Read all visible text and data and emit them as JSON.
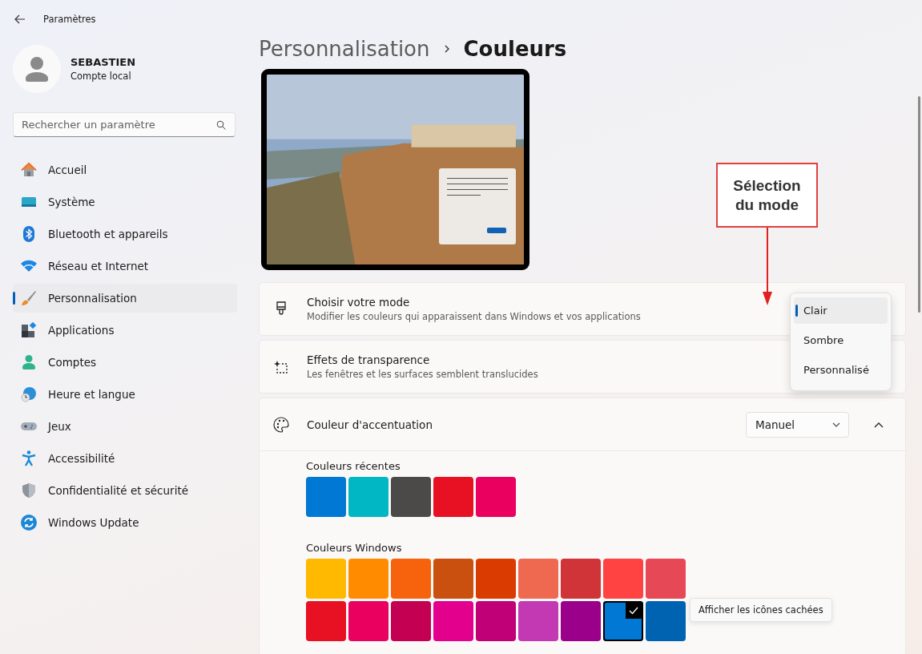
{
  "window": {
    "title": "Paramètres"
  },
  "user": {
    "name": "SEBASTIEN",
    "account": "Compte local"
  },
  "search": {
    "placeholder": "Rechercher un paramètre"
  },
  "sidebar": {
    "items": [
      {
        "label": "Accueil",
        "kind": "home",
        "selected": false
      },
      {
        "label": "Système",
        "kind": "system",
        "selected": false
      },
      {
        "label": "Bluetooth et appareils",
        "kind": "bluetooth",
        "selected": false
      },
      {
        "label": "Réseau et Internet",
        "kind": "network",
        "selected": false
      },
      {
        "label": "Personnalisation",
        "kind": "brush",
        "selected": true
      },
      {
        "label": "Applications",
        "kind": "apps",
        "selected": false
      },
      {
        "label": "Comptes",
        "kind": "accounts",
        "selected": false
      },
      {
        "label": "Heure et langue",
        "kind": "time",
        "selected": false
      },
      {
        "label": "Jeux",
        "kind": "games",
        "selected": false
      },
      {
        "label": "Accessibilité",
        "kind": "accessibility",
        "selected": false
      },
      {
        "label": "Confidentialité et sécurité",
        "kind": "privacy",
        "selected": false
      },
      {
        "label": "Windows Update",
        "kind": "update",
        "selected": false
      }
    ]
  },
  "breadcrumb": {
    "parent": "Personnalisation",
    "current": "Couleurs"
  },
  "cards": [
    {
      "kind": "mode",
      "title": "Choisir votre mode",
      "description": "Modifier les couleurs qui apparaissent dans Windows et vos applications"
    },
    {
      "kind": "transparency",
      "title": "Effets de transparence",
      "description": "Les fenêtres et les surfaces semblent translucides"
    },
    {
      "kind": "accent",
      "title": "Couleur d'accentuation",
      "dropdown": "Manuel",
      "expanded": true
    }
  ],
  "mode_menu": {
    "options": [
      {
        "label": "Clair",
        "selected": true
      },
      {
        "label": "Sombre",
        "selected": false
      },
      {
        "label": "Personnalisé",
        "selected": false
      }
    ]
  },
  "recent_colors": {
    "title": "Couleurs récentes",
    "swatches": [
      {
        "color": "#0078d4"
      },
      {
        "color": "#00b7c3"
      },
      {
        "color": "#4c4a48"
      },
      {
        "color": "#e81123"
      },
      {
        "color": "#ea005e"
      }
    ]
  },
  "windows_colors": {
    "title": "Couleurs Windows",
    "swatches": [
      {
        "color": "#ffb900",
        "selected": false
      },
      {
        "color": "#ff8c00",
        "selected": false
      },
      {
        "color": "#f7630c",
        "selected": false
      },
      {
        "color": "#ca5010",
        "selected": false
      },
      {
        "color": "#da3b01",
        "selected": false
      },
      {
        "color": "#ef6950",
        "selected": false
      },
      {
        "color": "#d13438",
        "selected": false
      },
      {
        "color": "#ff4343",
        "selected": false
      },
      {
        "color": "#e74856",
        "selected": false
      },
      {
        "color": "#e81123",
        "selected": false
      },
      {
        "color": "#ea005e",
        "selected": false
      },
      {
        "color": "#c30052",
        "selected": false
      },
      {
        "color": "#e3008c",
        "selected": false
      },
      {
        "color": "#bf0077",
        "selected": false
      },
      {
        "color": "#c239b3",
        "selected": false
      },
      {
        "color": "#9a0089",
        "selected": false
      },
      {
        "color": "#0078d4",
        "selected": true
      },
      {
        "color": "#0063b1",
        "selected": false
      }
    ]
  },
  "tooltip": "Afficher les icônes cachées",
  "callout": {
    "lines": [
      "Sélection",
      "du mode"
    ]
  }
}
